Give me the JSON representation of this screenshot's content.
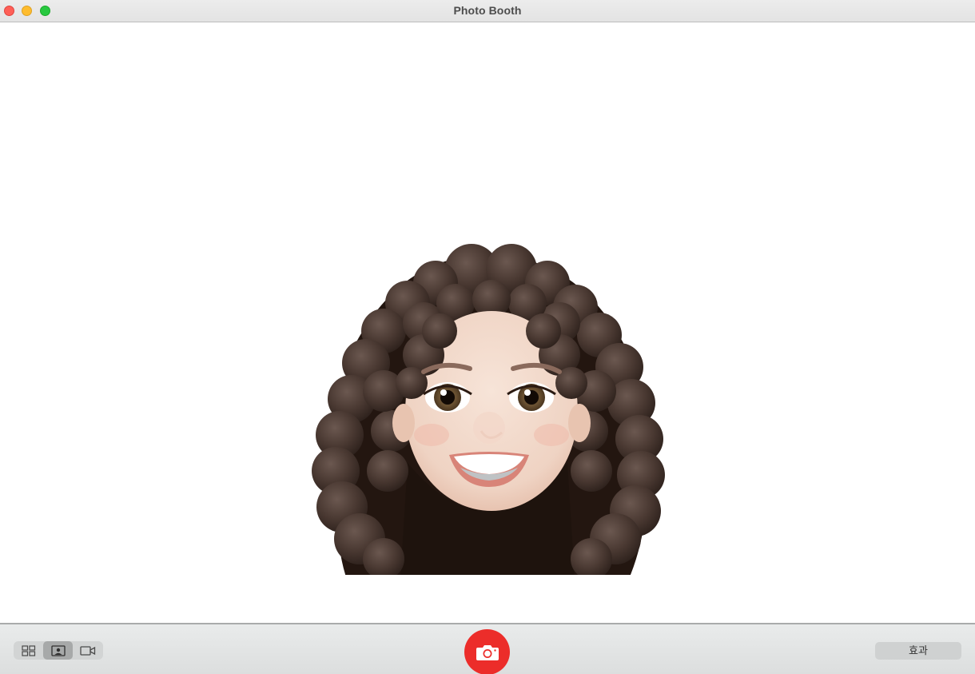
{
  "window": {
    "title": "Photo Booth"
  },
  "titlebar": {
    "buttons": [
      "close",
      "minimize",
      "zoom"
    ]
  },
  "preview": {
    "content": "memoji-avatar"
  },
  "toolbar": {
    "view_modes": [
      {
        "icon": "grid-icon",
        "active": false
      },
      {
        "icon": "single-photo-icon",
        "active": true
      },
      {
        "icon": "video-camera-icon",
        "active": false
      }
    ],
    "shutter_icon": "camera-icon",
    "effects_label": "효과"
  },
  "colors": {
    "shutter": "#ec2d2a",
    "close": "#fe5f57",
    "minimize": "#febc2e",
    "zoom": "#28c840",
    "hair": "#3f2f28",
    "skin": "#f1d7c8"
  }
}
